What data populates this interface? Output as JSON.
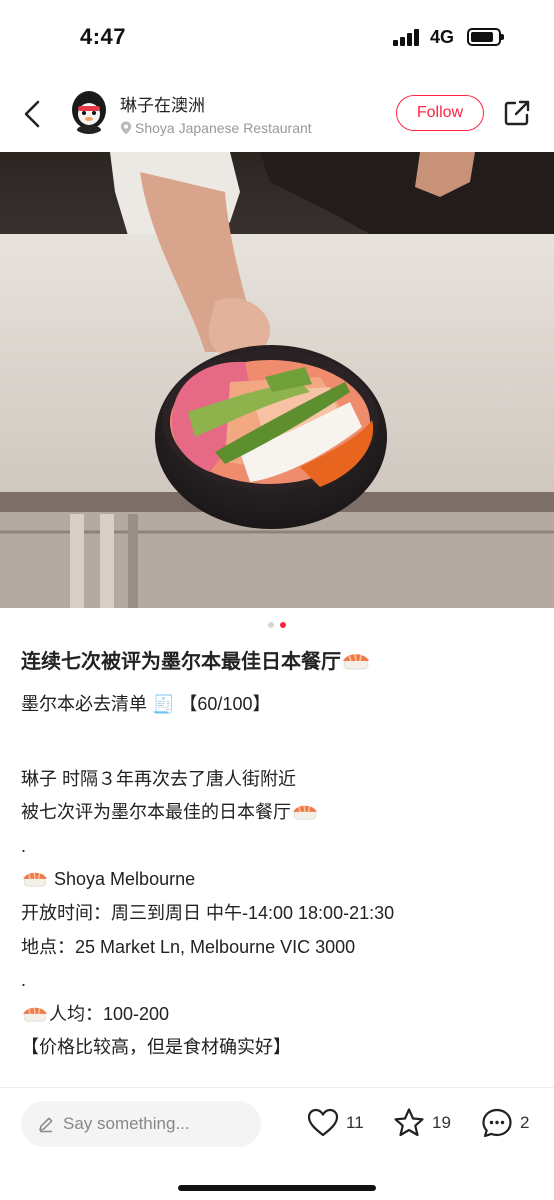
{
  "status_bar": {
    "time": "4:47",
    "network": "4G"
  },
  "header": {
    "author_name": "琳子在澳洲",
    "location": "Shoya Japanese Restaurant",
    "follow_label": "Follow"
  },
  "media": {
    "slide_count": 2,
    "active_slide": 2
  },
  "post": {
    "title": "连续七次被评为墨尔本最佳日本餐厅",
    "subtitle": "墨尔本必去清单 🧾 【60/100】",
    "lines": [
      "琳子 时隔３年再次去了唐人街附近",
      "被七次评为墨尔本最佳的日本餐厅",
      ".",
      "Shoya Melbourne",
      "开放时间：周三到周日 中午-14:00 18:00-21:30",
      "地点：25 Market Ln, Melbourne VIC 3000",
      ".",
      "人均：100-200",
      "【价格比较高，但是食材确实好】"
    ]
  },
  "bottom_bar": {
    "comment_placeholder": "Say something...",
    "likes": "11",
    "favorites": "19",
    "comments": "2"
  },
  "colors": {
    "accent": "#ff2442"
  },
  "icons": [
    "back-arrow-icon",
    "location-pin-icon",
    "share-icon",
    "pen-icon",
    "heart-icon",
    "star-icon",
    "comment-icon",
    "sushi-emoji"
  ]
}
